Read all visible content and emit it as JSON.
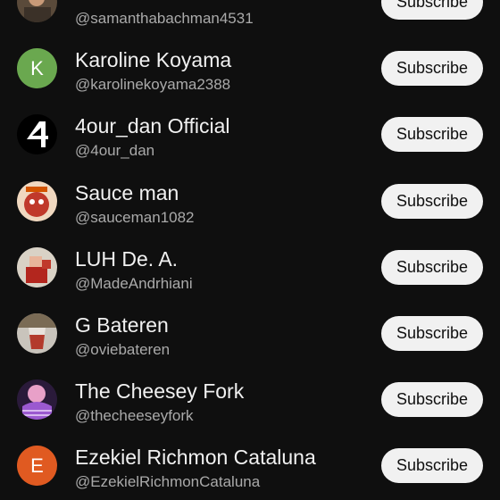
{
  "subscribe_label": "Subscribe",
  "channels": [
    {
      "name": "",
      "handle": "@samanthabachman4531",
      "avatar_icon": "photo-avatar-icon"
    },
    {
      "name": "Karoline Koyama",
      "handle": "@karolinekoyama2388",
      "avatar_letter": "K",
      "avatar_color": "#6aa84f"
    },
    {
      "name": "4our_dan Official",
      "handle": "@4our_dan",
      "avatar_icon": "four-logo-avatar-icon"
    },
    {
      "name": "Sauce man",
      "handle": "@sauceman1082",
      "avatar_icon": "red-character-avatar-icon"
    },
    {
      "name": "LUH De. A.",
      "handle": "@MadeAndrhiani",
      "avatar_icon": "roblox-character-avatar-icon"
    },
    {
      "name": "G Bateren",
      "handle": "@oviebateren",
      "avatar_icon": "drink-glass-avatar-icon"
    },
    {
      "name": "The Cheesey Fork",
      "handle": "@thecheeseyfork",
      "avatar_icon": "purple-cat-avatar-icon"
    },
    {
      "name": "Ezekiel Richmon Cataluna",
      "handle": "@EzekielRichmonCataluna",
      "avatar_letter": "E",
      "avatar_color": "#e05a21"
    }
  ]
}
